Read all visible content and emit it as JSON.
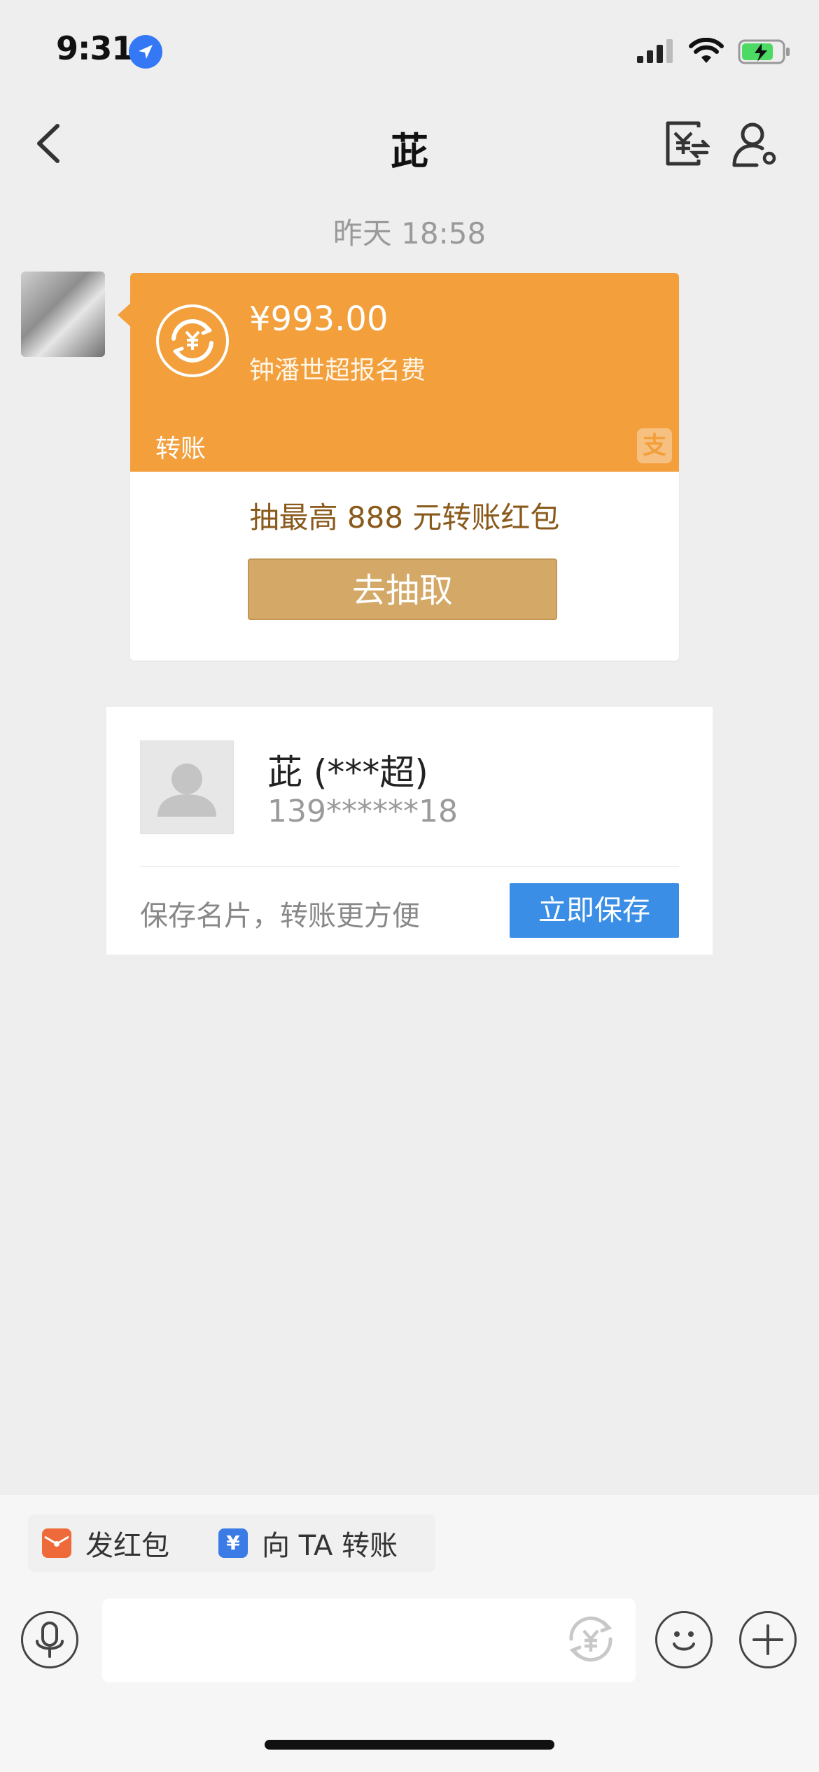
{
  "status_bar": {
    "time": "9:31"
  },
  "nav": {
    "title": "茈"
  },
  "chat": {
    "timestamp": "昨天 18:58",
    "transfer_card": {
      "amount": "¥993.00",
      "description": "钟潘世超报名费",
      "type_label": "转账",
      "alipay_glyph": "支",
      "promo_text": "抽最高 888 元转账红包",
      "action_label": "去抽取"
    },
    "contact_card": {
      "name": "茈 (***超)",
      "phone": "139******18",
      "hint": "保存名片，转账更方便",
      "save_label": "立即保存"
    }
  },
  "quick_actions": [
    {
      "label": "发红包",
      "icon": "red-envelope-icon",
      "color": "#ee6a3a"
    },
    {
      "label": "向 TA 转账",
      "icon": "transfer-icon",
      "glyph": "¥",
      "color": "#3a7be6"
    }
  ],
  "input_bar": {
    "placeholder": ""
  },
  "colors": {
    "accent_orange": "#f29f3c",
    "accent_blue": "#3a8ee6",
    "gold_button": "#d4a866"
  }
}
